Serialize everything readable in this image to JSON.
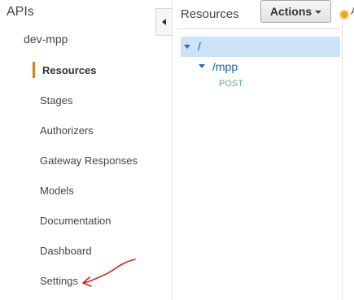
{
  "sidebar": {
    "apis_title": "APIs",
    "api_name": "dev-mpp",
    "items": [
      {
        "label": "Resources",
        "active": true
      },
      {
        "label": "Stages",
        "active": false
      },
      {
        "label": "Authorizers",
        "active": false
      },
      {
        "label": "Gateway Responses",
        "active": false
      },
      {
        "label": "Models",
        "active": false
      },
      {
        "label": "Documentation",
        "active": false
      },
      {
        "label": "Dashboard",
        "active": false
      },
      {
        "label": "Settings",
        "active": false
      }
    ]
  },
  "resources": {
    "title": "Resources",
    "actions_label": "Actions",
    "tree": {
      "root_path": "/",
      "child_path": "/mpp",
      "method": "POST"
    }
  },
  "right_edge": {
    "text": "A"
  },
  "colors": {
    "active_accent": "#e07b24",
    "selected_row": "#cde3f7",
    "link_blue": "#1a5fb4",
    "method_green": "#5ab576",
    "annotation_red": "#e0211d"
  },
  "icons": {
    "collapse": "chevron-left-icon",
    "tree_toggle": "caret-down-icon",
    "actions_caret": "caret-down-icon",
    "status": "status-dot-icon",
    "annotation": "red-arrow-icon"
  }
}
